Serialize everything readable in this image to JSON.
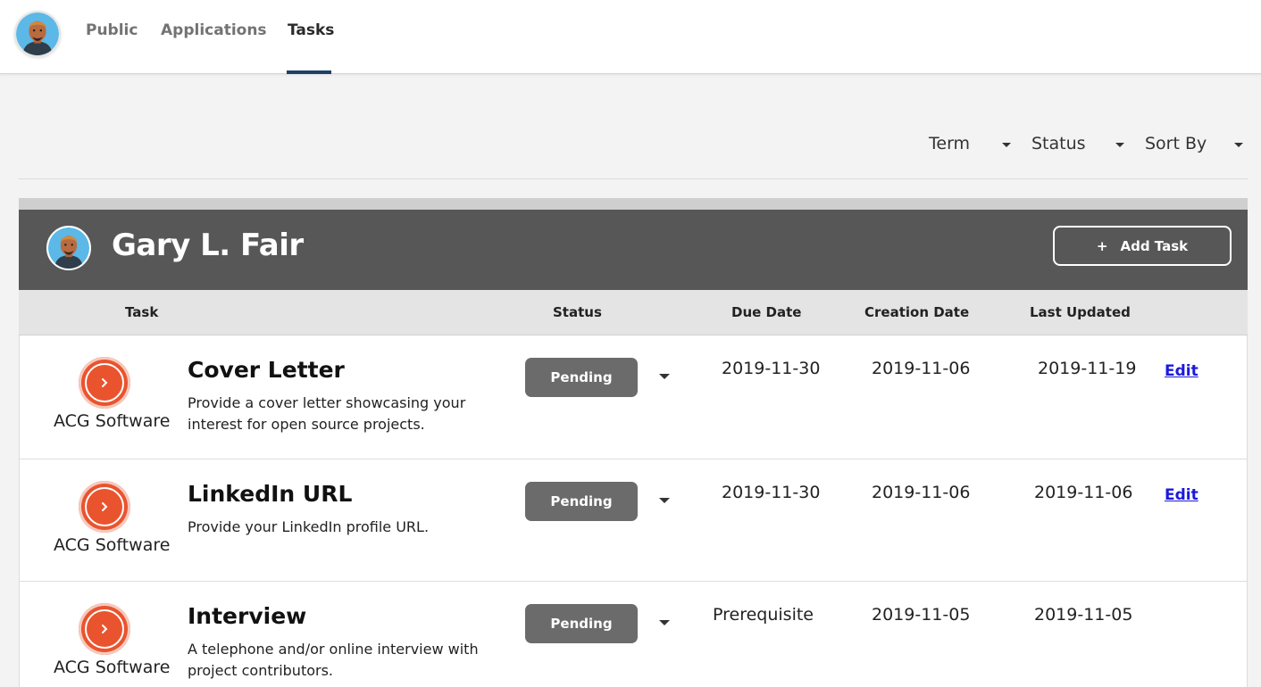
{
  "nav": {
    "tabs": [
      {
        "label": "Public"
      },
      {
        "label": "Applications"
      },
      {
        "label": "Tasks"
      }
    ],
    "active_tab": "Tasks"
  },
  "filters": {
    "term": "Term",
    "status": "Status",
    "sort_by": "Sort By"
  },
  "card": {
    "user_name": "Gary L. Fair",
    "add_task_icon": "+",
    "add_task_label": "Add Task"
  },
  "columns": {
    "task": "Task",
    "status": "Status",
    "due_date": "Due Date",
    "creation_date": "Creation Date",
    "last_updated": "Last Updated"
  },
  "rows": [
    {
      "org": "ACG Software",
      "title": "Cover Letter",
      "description": "Provide a cover letter showcasing your interest for open source projects.",
      "status": "Pending",
      "due_date": "2019-11-30",
      "creation_date": "2019-11-06",
      "last_updated": "2019-11-19",
      "action": "Edit"
    },
    {
      "org": "ACG Software",
      "title": "LinkedIn URL",
      "description": "Provide your LinkedIn profile URL.",
      "status": "Pending",
      "due_date": "2019-11-30",
      "creation_date": "2019-11-06",
      "last_updated": "2019-11-06",
      "action": "Edit"
    },
    {
      "org": "ACG Software",
      "title": "Interview",
      "description": "A telephone and/or online interview with project contributors.",
      "status": "Pending",
      "due_date": "Prerequisite",
      "creation_date": "2019-11-05",
      "last_updated": "2019-11-05",
      "action": ""
    }
  ],
  "colors": {
    "accent_orange": "#e9542e",
    "header_dark": "#575757",
    "tab_underline": "#1f3f66",
    "status_pill": "#6b6b6b",
    "link_blue": "#1a1adb"
  }
}
